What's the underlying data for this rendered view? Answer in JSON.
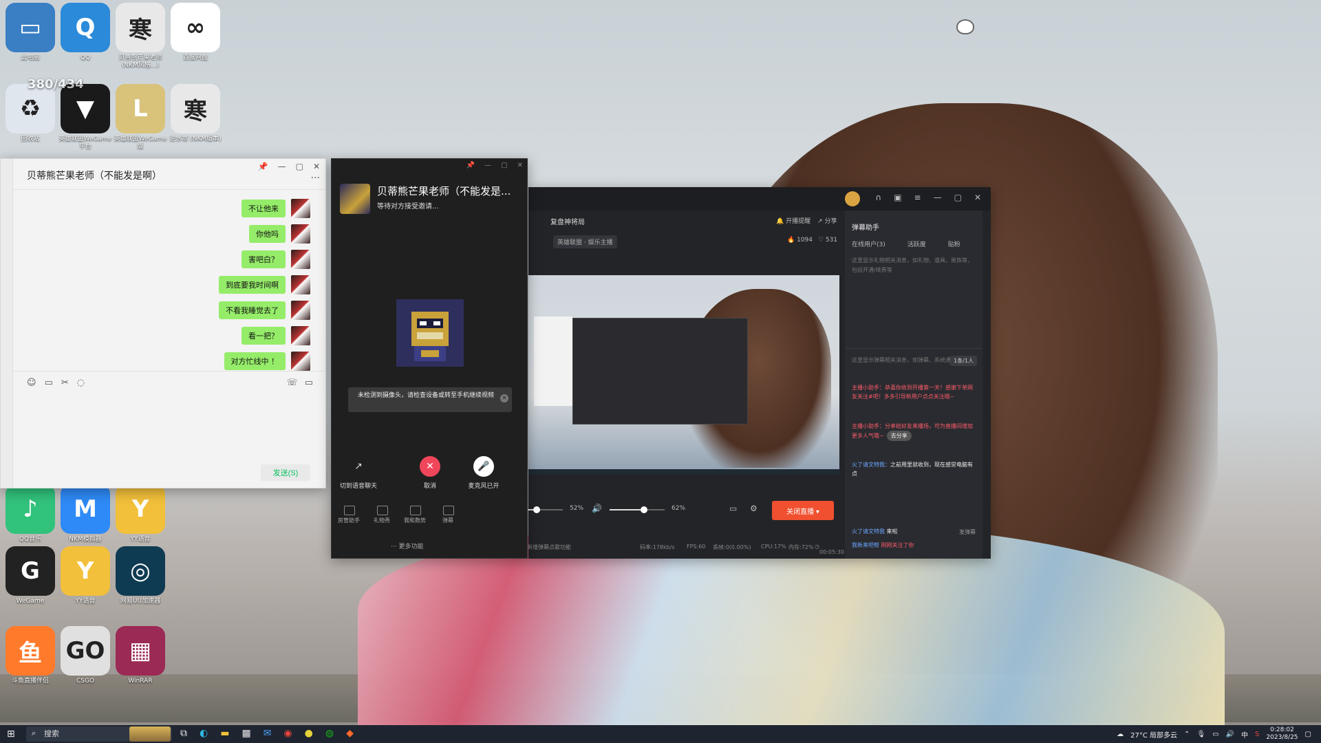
{
  "desktop": {
    "icons": [
      {
        "label": "此电脑",
        "color": "#3a7fc4",
        "glyph": "▭"
      },
      {
        "label": "QQ",
        "color": "#2b8ad9",
        "glyph": "Q"
      },
      {
        "label": "贝蒂熊芒果老师 (NKM风格...)",
        "color": "#e8e8e8",
        "glyph": "寒"
      },
      {
        "label": "百度网盘",
        "color": "#ffffff",
        "glyph": "∞"
      },
      {
        "label": "回收站",
        "color": "#dfe6ee",
        "glyph": "♻"
      },
      {
        "label": "英雄联盟WeGame平台",
        "color": "#1a1a1a",
        "glyph": "▼"
      },
      {
        "label": "英雄联盟WeGame版",
        "color": "#d9c27a",
        "glyph": "L"
      },
      {
        "label": "逆水寒 (NKM版本)",
        "color": "#e8e8e8",
        "glyph": "寒"
      },
      {
        "label": "QQ音乐",
        "color": "#31c27c",
        "glyph": "♪"
      },
      {
        "label": "NKM模拟器",
        "color": "#2e8af6",
        "glyph": "M"
      },
      {
        "label": "YY语音",
        "color": "#f2c03a",
        "glyph": "Y"
      },
      {
        "label": "WeGame",
        "color": "#222",
        "glyph": "G"
      },
      {
        "label": "YY语音",
        "color": "#f2c03a",
        "glyph": "Y"
      },
      {
        "label": "网易UU加速器",
        "color": "#0f3b52",
        "glyph": "◎"
      },
      {
        "label": "斗鱼直播伴侣",
        "color": "#ff7a2a",
        "glyph": "鱼"
      },
      {
        "label": "CSGO",
        "color": "#e0e0e0",
        "glyph": "GO"
      },
      {
        "label": "WinRAR",
        "color": "#9b2a55",
        "glyph": "▦"
      }
    ],
    "overlay_text": "380/434"
  },
  "chat": {
    "title": "贝蒂熊芒果老师（不能发是啊）",
    "messages": [
      "不让他来",
      "你他吗",
      "害吧白？",
      "到底要我时间啊",
      "不看我睡觉去了",
      "看一把？",
      "对方忙线中  ！"
    ],
    "send_label": "发送(S)",
    "window_controls": [
      "📌",
      "—",
      "▢",
      "✕"
    ]
  },
  "call": {
    "name": "贝蒂熊芒果老师（不能发是...",
    "status": "等待对方接受邀请...",
    "warning": "未检测到摄像头，请检查设备或转至手机继续视频",
    "buttons": [
      {
        "label": "切到语音聊天",
        "glyph": "↗",
        "color": "transparent"
      },
      {
        "label": "取消",
        "glyph": "✕",
        "color": "#f0465a"
      },
      {
        "label": "麦克风已开",
        "glyph": "🎤",
        "color": "#ffffff"
      }
    ],
    "tools": [
      "房管助手",
      "礼物秀",
      "我和数势",
      "弹幕"
    ],
    "more": "··· 更多功能"
  },
  "live": {
    "room_title": "复盘神将局",
    "game": "英雄联盟 · 娱乐主播",
    "actions": [
      "开播提醒",
      "分享"
    ],
    "hot": "1094",
    "likes": "531",
    "panel_title": "弹幕助手",
    "tabs": [
      "在线用户(3)",
      "活跃度",
      "贴粉"
    ],
    "panel_desc": "这里显示礼物相关消息，如礼物、道具、贵族等，包括开通/续费等",
    "danmu_desc": "这里显示弹幕相关消息，如弹幕、系统通知等",
    "online_badge": "1条/1人",
    "messages": [
      {
        "prefix": "主播小助手：",
        "text": "恭喜你收到开播第一天！感谢下单网友关注#吧！多多引导新用户点点关注哦~",
        "color": "red"
      },
      {
        "prefix": "主播小助手：",
        "text": "分享给好友来播场，可为直播间增加更多人气哦~",
        "color": "red",
        "badge": "去分享"
      },
      {
        "prefix": "火了请文特我：",
        "text": "之前用里就收到，现在感觉电脑有点",
        "color": "white"
      }
    ],
    "bottom_msgs": [
      {
        "name": "火了请文特我",
        "text": "来啦"
      },
      {
        "name": "我新来吧帮",
        "text": "刚刚关注了你"
      }
    ],
    "send_danmu": "发弹幕",
    "mic_pct": "52%",
    "mic_level": 0.52,
    "vol_pct": "62%",
    "vol_level": 0.62,
    "stop_label": "关闭直播",
    "status": {
      "music": "【正在播放】新增弹幕点歌功能",
      "bitrate": "码率:178kb/s",
      "fps": "FPS:60",
      "loss": "丢帧:0(0.00%)",
      "cpu": "CPU:17%",
      "mem": "内存:72%",
      "time": "00:05:30"
    }
  },
  "taskbar": {
    "search_placeholder": "搜索",
    "weather": "27°C 局部多云",
    "ime": "中",
    "time": "0:28:02",
    "date": "2023/8/25"
  }
}
